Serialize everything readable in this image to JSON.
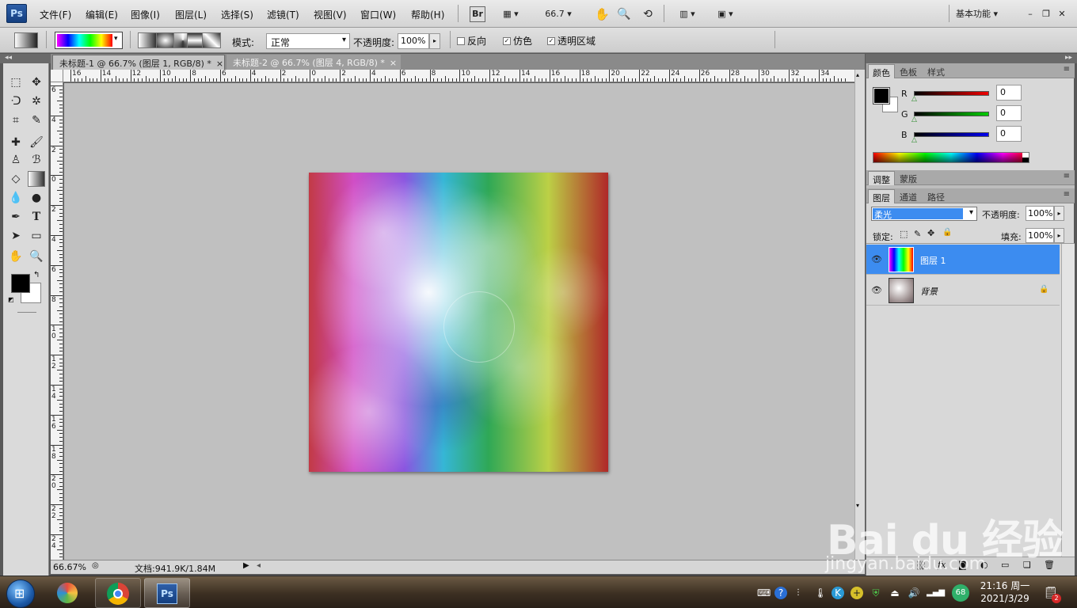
{
  "menubar": {
    "logo": "Ps",
    "items": [
      "文件(F)",
      "编辑(E)",
      "图像(I)",
      "图层(L)",
      "选择(S)",
      "滤镜(T)",
      "视图(V)",
      "窗口(W)",
      "帮助(H)"
    ],
    "br_label": "Br",
    "zoom_value": "66.7",
    "workspace": "基本功能"
  },
  "options": {
    "mode_label": "模式:",
    "mode_value": "正常",
    "opacity_label": "不透明度:",
    "opacity_value": "100%",
    "reverse_label": "反向",
    "dither_label": "仿色",
    "transparency_label": "透明区域",
    "dither_checked": true,
    "transparency_checked": true,
    "reverse_checked": false
  },
  "tabs": [
    {
      "label": "未标题-1 @ 66.7% (图层 1, RGB/8) *",
      "active": true
    },
    {
      "label": "未标题-2 @ 66.7% (图层 4, RGB/8) *",
      "active": false
    }
  ],
  "ruler": {
    "top": [
      "16",
      "14",
      "12",
      "10",
      "8",
      "6",
      "4",
      "2",
      "0",
      "2",
      "4",
      "6",
      "8",
      "10",
      "12",
      "14",
      "16",
      "18",
      "20",
      "22",
      "24",
      "26",
      "28",
      "30",
      "32",
      "34"
    ],
    "left": [
      "6",
      "4",
      "2",
      "0",
      "2",
      "4",
      "6",
      "8",
      "1 0",
      "1 2",
      "1 4",
      "1 6",
      "1 8",
      "2 0",
      "2 2",
      "2 4"
    ]
  },
  "statusbar": {
    "zoom": "66.67%",
    "doc_info": "文档:941.9K/1.84M"
  },
  "color_panel": {
    "tabs": [
      "颜色",
      "色板",
      "样式"
    ],
    "channels": [
      {
        "label": "R",
        "value": "0"
      },
      {
        "label": "G",
        "value": "0"
      },
      {
        "label": "B",
        "value": "0"
      }
    ],
    "foreground": "#000000",
    "background": "#ffffff"
  },
  "adjust_panel": {
    "tabs": [
      "调整",
      "蒙版"
    ]
  },
  "layers_panel": {
    "tabs": [
      "图层",
      "通道",
      "路径"
    ],
    "blend_mode": "柔光",
    "opacity_label": "不透明度:",
    "opacity_value": "100%",
    "lock_label": "锁定:",
    "fill_label": "填充:",
    "fill_value": "100%",
    "layers": [
      {
        "name": "图层 1",
        "selected": true
      },
      {
        "name": "背景",
        "selected": false,
        "locked": true
      }
    ]
  },
  "taskbar": {
    "time": "21:16 周一",
    "date": "2021/3/29",
    "badge": "68",
    "notif_count": "2",
    "ps_label": "Ps"
  },
  "watermark": {
    "brand": "Bai du 经验",
    "url": "jingyan.baidu.com"
  }
}
